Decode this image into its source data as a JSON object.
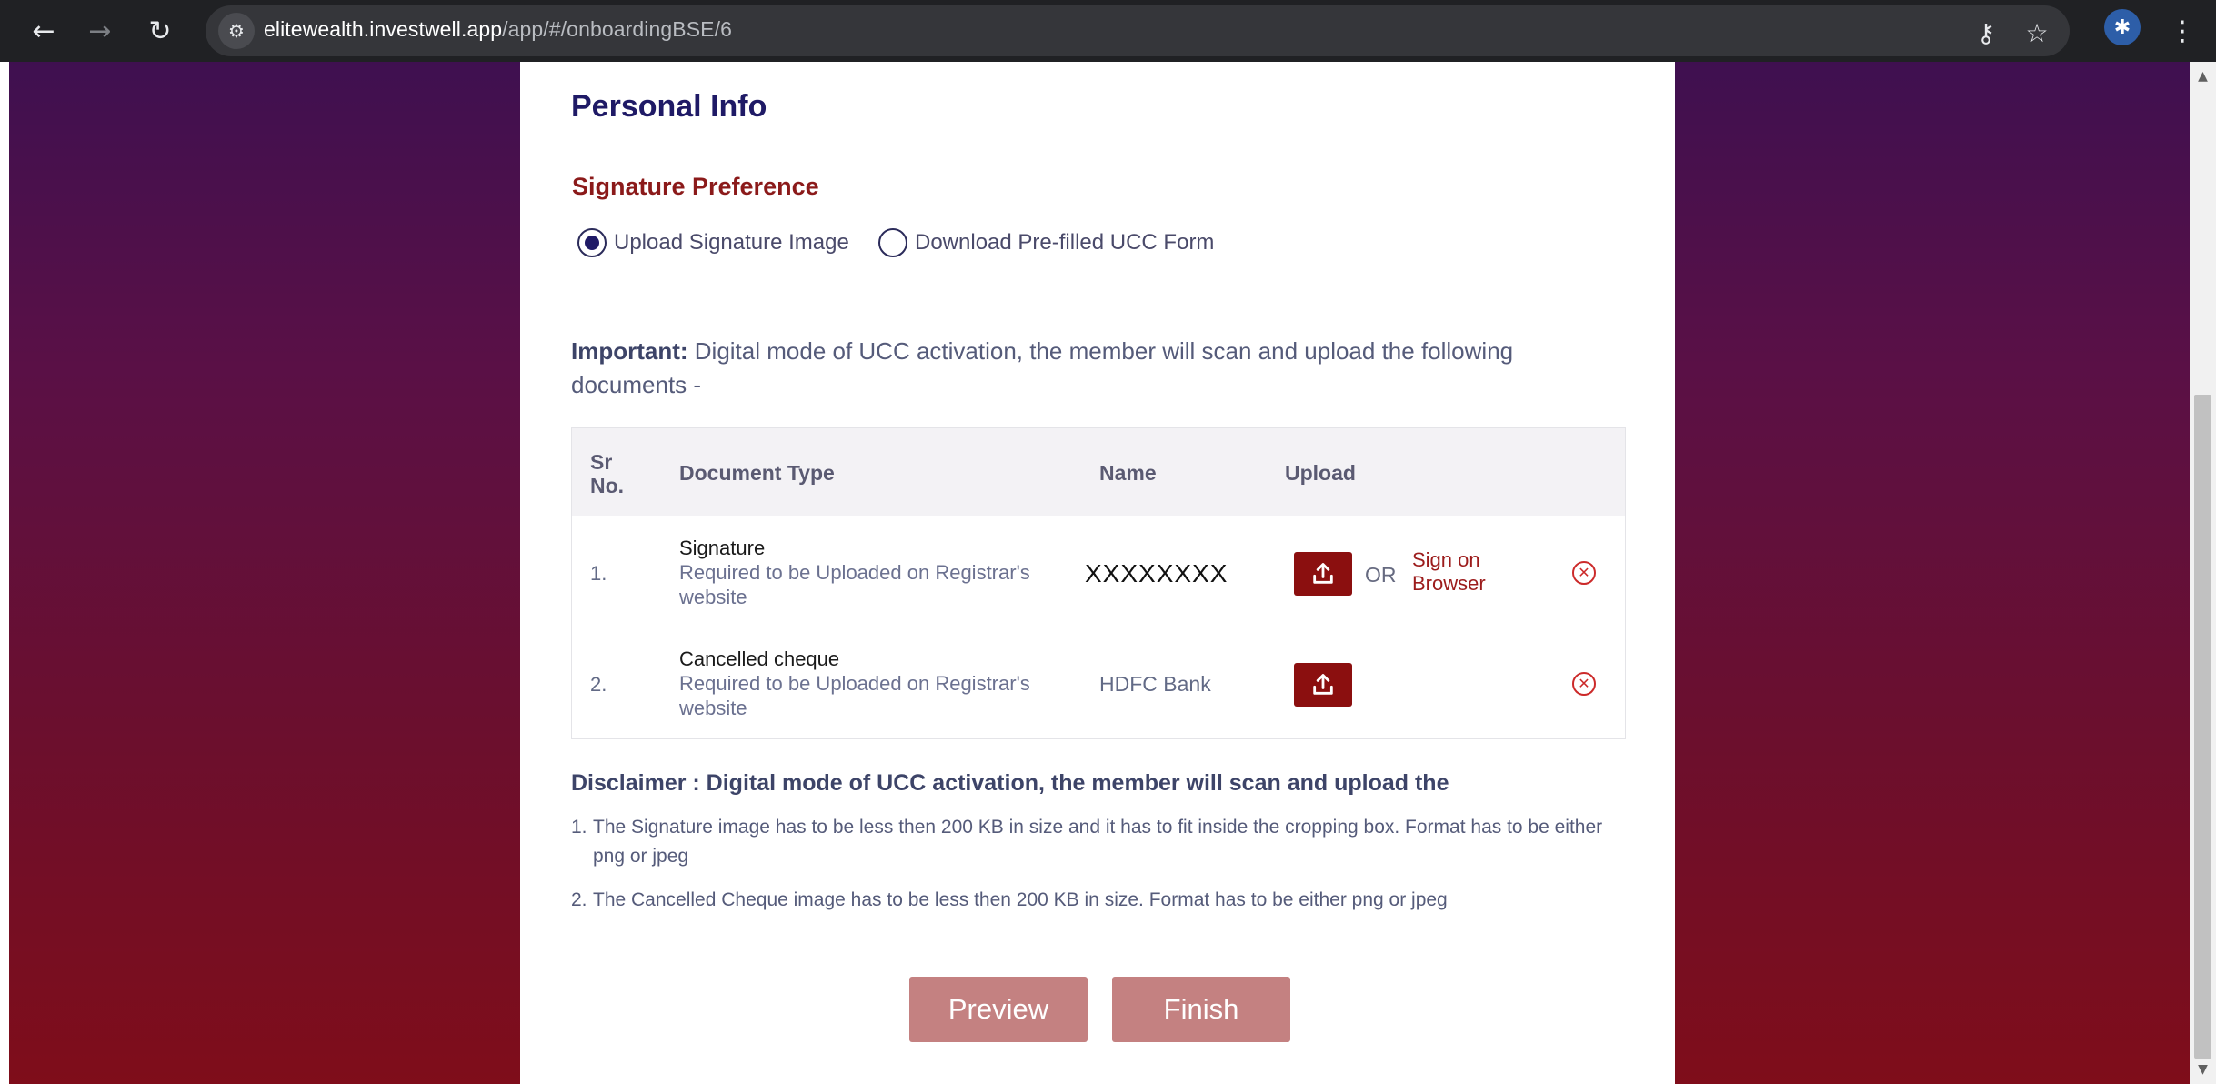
{
  "browser": {
    "url_host": "elitewealth.investwell.app",
    "url_path": "/app/#/onboardingBSE/6",
    "icons": [
      "back-arrow-icon",
      "forward-arrow-icon",
      "reload-icon",
      "site-settings-icon",
      "password-key-icon",
      "bookmark-star-icon",
      "extension-icon",
      "menu-dots-icon"
    ]
  },
  "page": {
    "title": "Personal Info",
    "signature_section": {
      "heading": "Signature Preference",
      "options": [
        {
          "label": "Upload Signature Image",
          "selected": true
        },
        {
          "label": "Download Pre-filled UCC Form",
          "selected": false
        }
      ]
    },
    "important": {
      "label": "Important:",
      "text": " Digital mode of UCC activation, the member will scan and upload the following documents -"
    },
    "table": {
      "headers": {
        "sr_line1": "Sr",
        "sr_line2": "No.",
        "doc_type": "Document Type",
        "name": "Name",
        "upload": "Upload"
      },
      "rows": [
        {
          "sr": "1.",
          "doc_title": "Signature",
          "doc_sub": "Required to be Uploaded on Registrar's website",
          "name": "XXXXXXXX",
          "or": "OR",
          "sign_line1": "Sign on",
          "sign_line2": "Browser"
        },
        {
          "sr": "2.",
          "doc_title": "Cancelled cheque",
          "doc_sub": "Required to be Uploaded on Registrar's website",
          "name": "HDFC Bank"
        }
      ]
    },
    "disclaimer": {
      "title": "Disclaimer : Digital mode of UCC activation, the member will scan and upload the",
      "items": [
        {
          "num": "1.",
          "text": "The Signature image has to be less then 200 KB in size and it has to fit inside the cropping box. Format has to be either png or jpeg"
        },
        {
          "num": "2.",
          "text": "The Cancelled Cheque image has to be less then 200 KB in size. Format has to be either png or jpeg"
        }
      ]
    },
    "buttons": {
      "preview": "Preview",
      "finish": "Finish"
    }
  },
  "colors": {
    "title": "#1f1a66",
    "section_heading": "#8b1a1a",
    "upload_button": "#8b0f0f",
    "action_button": "#c48181",
    "remove_icon": "#cc2a2a"
  }
}
